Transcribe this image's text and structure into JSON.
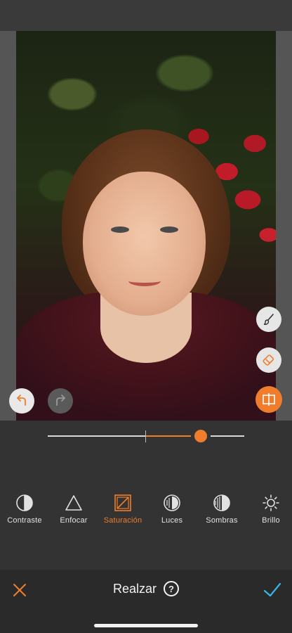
{
  "editor": {
    "title": "Realzar",
    "help_icon": "?",
    "cancel_icon": "close-icon",
    "confirm_icon": "checkmark-icon"
  },
  "canvas": {
    "undo_icon": "undo-icon",
    "redo_icon": "redo-icon",
    "side_tools": [
      "brush-icon",
      "eraser-icon",
      "compare-icon"
    ]
  },
  "slider": {
    "value": 0.78,
    "center": 0.5
  },
  "tools": [
    {
      "label": "Contraste",
      "icon": "contrast-icon"
    },
    {
      "label": "Enfocar",
      "icon": "sharpen-icon"
    },
    {
      "label": "Saturación",
      "icon": "saturation-icon",
      "active": true
    },
    {
      "label": "Luces",
      "icon": "highlights-icon"
    },
    {
      "label": "Sombras",
      "icon": "shadows-icon"
    },
    {
      "label": "Brillo",
      "icon": "brightness-icon"
    }
  ],
  "colors": {
    "accent": "#f07d2b",
    "confirm": "#35b6e6",
    "background": "#333333"
  }
}
